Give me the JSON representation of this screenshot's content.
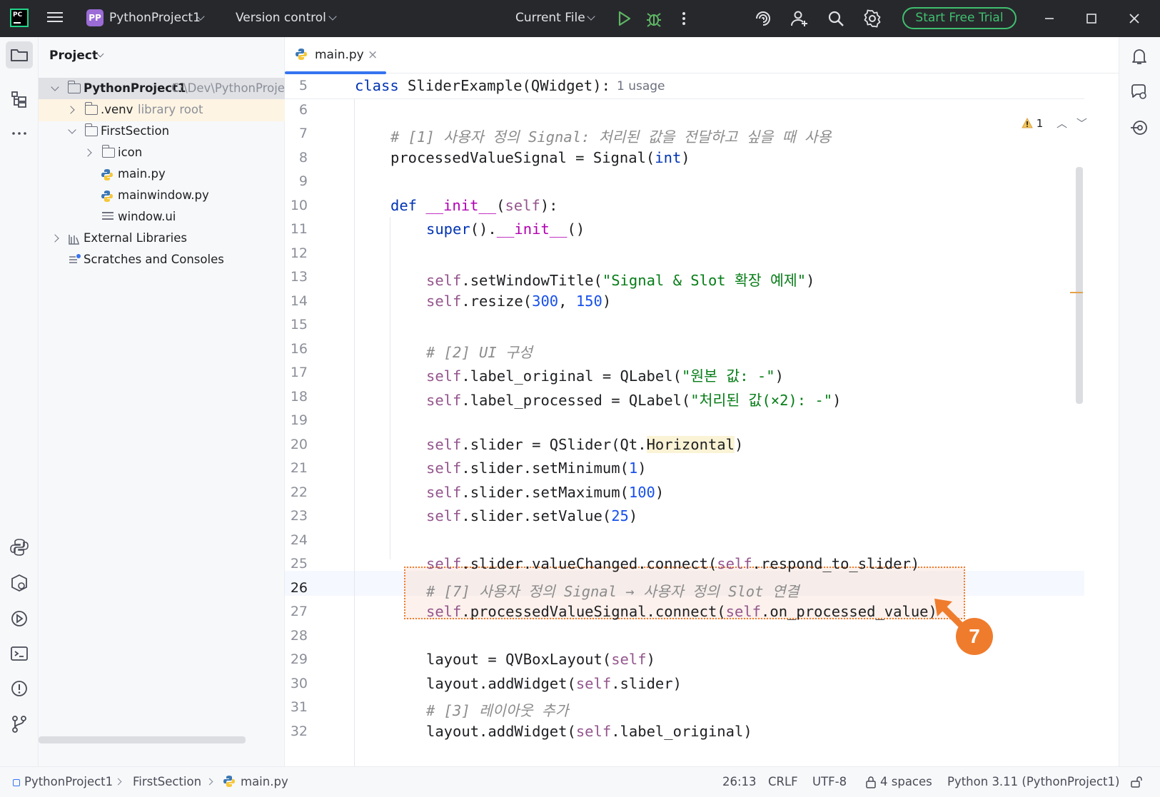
{
  "titlebar": {
    "logo": "PC",
    "project_badge": "PP",
    "project_name": "PythonProject1",
    "vcs": "Version control",
    "run_config": "Current File",
    "trial_button": "Start Free Trial"
  },
  "project_panel": {
    "title": "Project",
    "tree": [
      {
        "label": "PythonProject1",
        "hint": "C:\\Dev\\PythonProje",
        "icon": "folder-icon"
      },
      {
        "label": ".venv",
        "hint": "library root",
        "icon": "folder-icon"
      },
      {
        "label": "FirstSection",
        "icon": "folder-icon"
      },
      {
        "label": "icon",
        "icon": "folder-icon"
      },
      {
        "label": "main.py",
        "icon": "python-file-icon"
      },
      {
        "label": "mainwindow.py",
        "icon": "python-file-icon"
      },
      {
        "label": "window.ui",
        "icon": "ui-file-icon"
      },
      {
        "label": "External Libraries",
        "icon": "library-icon"
      },
      {
        "label": "Scratches and Consoles",
        "icon": "scratches-icon"
      }
    ]
  },
  "editor": {
    "tab_label": "main.py",
    "tab_close": "×",
    "usage_hint": "1 usage",
    "warning_count": "1",
    "lines": [
      {
        "n": "5",
        "code": "class SliderExample(QWidget):"
      },
      {
        "n": "6",
        "code": ""
      },
      {
        "n": "7",
        "code": "# [1] 사용자 정의 Signal: 처리된 값을 전달하고 싶을 때 사용"
      },
      {
        "n": "8",
        "code": "processedValueSignal = Signal(int)"
      },
      {
        "n": "9",
        "code": ""
      },
      {
        "n": "10",
        "code": "def __init__(self):"
      },
      {
        "n": "11",
        "code": "super().__init__()"
      },
      {
        "n": "12",
        "code": ""
      },
      {
        "n": "13",
        "code": "self.setWindowTitle(\"Signal & Slot 확장 예제\")"
      },
      {
        "n": "14",
        "code": "self.resize(300, 150)"
      },
      {
        "n": "15",
        "code": ""
      },
      {
        "n": "16",
        "code": "# [2] UI 구성"
      },
      {
        "n": "17",
        "code": "self.label_original = QLabel(\"원본 값: -\")"
      },
      {
        "n": "18",
        "code": "self.label_processed = QLabel(\"처리된 값(×2): -\")"
      },
      {
        "n": "19",
        "code": ""
      },
      {
        "n": "20",
        "code": "self.slider = QSlider(Qt.Horizontal)"
      },
      {
        "n": "21",
        "code": "self.slider.setMinimum(1)"
      },
      {
        "n": "22",
        "code": "self.slider.setMaximum(100)"
      },
      {
        "n": "23",
        "code": "self.slider.setValue(25)"
      },
      {
        "n": "24",
        "code": ""
      },
      {
        "n": "25",
        "code": "self.slider.valueChanged.connect(self.respond_to_slider)"
      },
      {
        "n": "26",
        "code": "# [7] 사용자 정의 Signal → 사용자 정의 Slot 연결"
      },
      {
        "n": "27",
        "code": "self.processedValueSignal.connect(self.on_processed_value)"
      },
      {
        "n": "28",
        "code": ""
      },
      {
        "n": "29",
        "code": "layout = QVBoxLayout(self)"
      },
      {
        "n": "30",
        "code": "layout.addWidget(self.slider)"
      },
      {
        "n": "31",
        "code": "# [3] 레이아웃 추가"
      },
      {
        "n": "32",
        "code": "layout.addWidget(self.label_original)"
      }
    ],
    "callout_number": "7"
  },
  "statusbar": {
    "breadcrumb": [
      "PythonProject1",
      "FirstSection",
      "main.py"
    ],
    "position": "26:13",
    "line_sep": "CRLF",
    "encoding": "UTF-8",
    "indent": "4 spaces",
    "interpreter": "Python 3.11 (PythonProject1)"
  },
  "colors": {
    "accent": "#3574f0",
    "callout": "#ef7c2d",
    "trial": "#3fbf6f"
  }
}
